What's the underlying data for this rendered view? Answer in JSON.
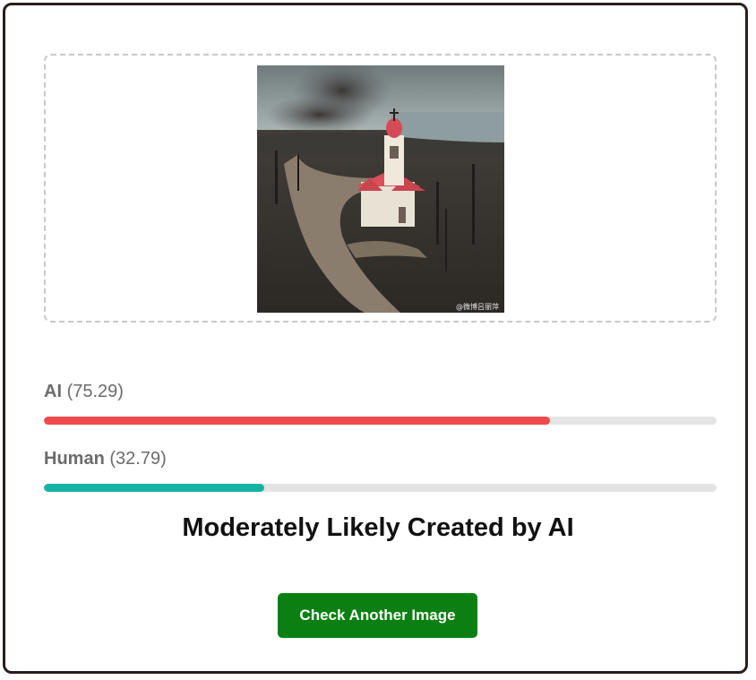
{
  "upload": {
    "image_alt": "Aerial view of a white church with a red roof amid burned land and smoke",
    "watermark": "@微博吕丽萍"
  },
  "results": [
    {
      "label": "AI",
      "score": "(75.29)",
      "percent": 75.29,
      "color": "#f04a4d"
    },
    {
      "label": "Human",
      "score": "(32.79)",
      "percent": 32.79,
      "color": "#16b3a4"
    }
  ],
  "verdict": "Moderately Likely Created by AI",
  "action": {
    "check_another_label": "Check Another Image"
  }
}
